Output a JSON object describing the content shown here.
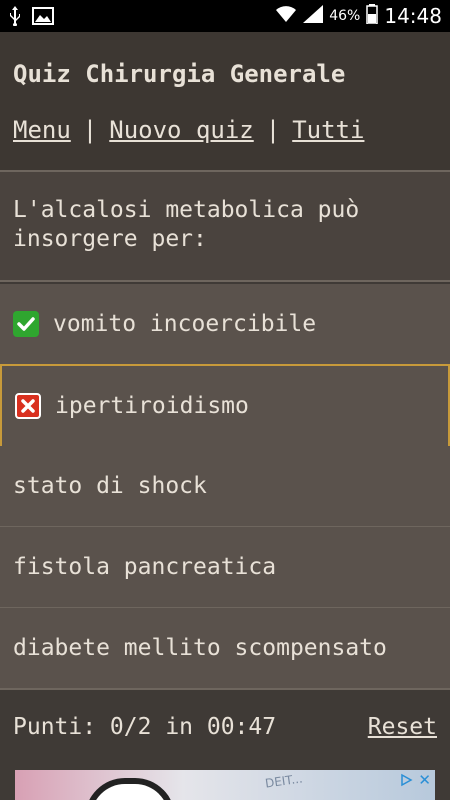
{
  "status": {
    "battery": "46%",
    "time": "14:48"
  },
  "header": {
    "title": "Quiz Chirurgia Generale",
    "nav": {
      "menu": "Menu",
      "separator": "|",
      "new_quiz": "Nuovo quiz",
      "all": "Tutti"
    }
  },
  "question": "L'alcalosi metabolica può insorgere per:",
  "answers": [
    {
      "label": "vomito incoercibile",
      "mark": "correct"
    },
    {
      "label": "ipertiroidismo",
      "mark": "wrong"
    },
    {
      "label": "stato di shock",
      "mark": "none"
    },
    {
      "label": "fistola pancreatica",
      "mark": "none"
    },
    {
      "label": "diabete mellito scompensato",
      "mark": "none"
    }
  ],
  "footer": {
    "score": "Punti: 0/2 in 00:47",
    "reset": "Reset"
  },
  "ad": {
    "text": "DEIT..."
  },
  "colors": {
    "correct": "#2fa62f",
    "wrong": "#d9301f",
    "selected_border": "#c79a3a",
    "background": "#3f3a36"
  }
}
